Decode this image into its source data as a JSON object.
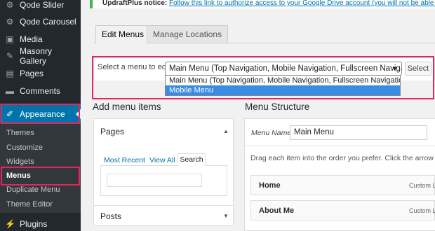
{
  "sidebar": {
    "items": [
      {
        "label": "Qode Slider",
        "icon": "slider-icon"
      },
      {
        "label": "Qode Carousel",
        "icon": "carousel-icon"
      },
      {
        "label": "Media",
        "icon": "media-icon"
      },
      {
        "label": "Masonry Gallery",
        "icon": "pin-icon"
      },
      {
        "label": "Pages",
        "icon": "page-icon"
      },
      {
        "label": "Comments",
        "icon": "comment-icon"
      },
      {
        "label": "Appearance",
        "icon": "brush-icon"
      }
    ],
    "submenu": [
      "Themes",
      "Customize",
      "Widgets",
      "Menus",
      "Duplicate Menu",
      "Theme Editor"
    ],
    "plugins": "Plugins"
  },
  "notice": {
    "bold": "UpdraftPlus notice:",
    "link": "Follow this link to authorize access to your Google Drive account (you will not be able to back"
  },
  "tabs": {
    "edit": "Edit Menus",
    "manage": "Manage Locations"
  },
  "selector": {
    "label": "Select a menu to edit:",
    "value": "Main Menu (Top Navigation, Mobile Navigation, Fullscreen Navigation)",
    "button": "Select",
    "options": [
      "Main Menu (Top Navigation, Mobile Navigation, Fullscreen Navigation)",
      "Mobile Menu"
    ]
  },
  "add_items": {
    "heading": "Add menu items",
    "pages_title": "Pages",
    "mini_tabs": [
      "Most Recent",
      "View All",
      "Search"
    ],
    "posts_title": "Posts"
  },
  "structure": {
    "heading": "Menu Structure",
    "name_label": "Menu Name",
    "name_value": "Main Menu",
    "drag_text": "Drag each item into the order you prefer. Click the arrow on the",
    "rows": [
      {
        "title": "Home",
        "type": "Custom Li"
      },
      {
        "title": "About Me",
        "type": "Custom Li"
      }
    ]
  },
  "colors": {
    "highlight": "#e5265b",
    "accent": "#0073aa",
    "sidebar": "#23282d"
  }
}
